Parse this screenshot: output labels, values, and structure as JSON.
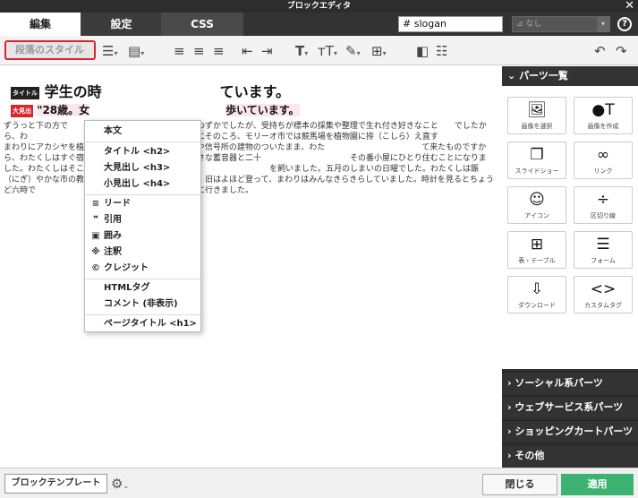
{
  "window": {
    "title": "ブロックエディタ",
    "close_glyph": "✕"
  },
  "tabs": [
    {
      "label": "編集"
    },
    {
      "label": "設定"
    },
    {
      "label": "CSS"
    }
  ],
  "header": {
    "id_field_value": "# slogan",
    "class_select_value": "なし",
    "class_select_icon": "tag-icon",
    "help_glyph": "?"
  },
  "toolbar": {
    "style_button_label": "段落のスタイル",
    "undo_icon": "undo-icon",
    "redo_icon": "redo-icon"
  },
  "content": {
    "h2_tag": "タイトル",
    "h2_text": "学生の時",
    "h2_text_tail": "ています。",
    "h3_tag": "大見出",
    "h3_text_a": "\"28歳。女",
    "h3_text_b": "歩いています。",
    "paragraph": "ずうっと下の方で　　　　　　　　　　　　　まんのわずかでしたが、受持ちが標本の採集や整理で生れ付き好きなこと　　でしたから、わ　　　　　　　　　　　　　たらきました。殊にそのころ、モリーオ市では競馬場を植物園に拵（こしら）え直す　　　　　　　　　　　　　まわりにアカシヤを植え込んだ広い地面が、切符売場や信号所の建物のついたまま、わた　　　　　　　　　　　　て来たものですから、わたくしはすぐ宿直という名前で月賦で買った小さな蓄音器と二十　　　　　　　　　　　その番小屋にひとり住むことになりました。わたくしはそこの馬を置く場所に板で小さ　　　　　　　　　　　を飼いました。五月のしまいの日曜でした。わたくしは賑（にぎ）やかな市の教会の鐘の　　　　　　　　　　　旧はよほど登って、まわりはみんなきらきらしていました。時計を見るとちょうど六時で　　　　　　　　　　　キだけ着て山羊を見に行きました。"
  },
  "style_menu": {
    "items": [
      {
        "label": "本文",
        "icon": ""
      },
      {
        "label": "タイトル <h2>",
        "icon": ""
      },
      {
        "label": "大見出し <h3>",
        "icon": ""
      },
      {
        "label": "小見出し <h4>",
        "icon": ""
      },
      {
        "label": "リード",
        "icon": "lead-icon"
      },
      {
        "label": "引用",
        "icon": "quote-icon"
      },
      {
        "label": "囲み",
        "icon": "box-icon"
      },
      {
        "label": "注釈",
        "icon": "note-icon"
      },
      {
        "label": "クレジット",
        "icon": "copyright-icon"
      },
      {
        "label": "HTMLタグ",
        "icon": ""
      },
      {
        "label": "コメント (非表示)",
        "icon": ""
      },
      {
        "label": "ページタイトル <h1>",
        "icon": ""
      }
    ]
  },
  "parts_panel": {
    "title": "パーツ一覧",
    "cards": [
      {
        "label": "画像を選択",
        "icon": "image-icon"
      },
      {
        "label": "画像を作成",
        "icon": "image-create-icon"
      },
      {
        "label": "スライドショー",
        "icon": "slideshow-icon"
      },
      {
        "label": "リンク",
        "icon": "link-icon"
      },
      {
        "label": "アイコン",
        "icon": "smiley-icon"
      },
      {
        "label": "区切り線",
        "icon": "divider-icon"
      },
      {
        "label": "表・テーブル",
        "icon": "table-icon"
      },
      {
        "label": "フォーム",
        "icon": "form-icon"
      },
      {
        "label": "ダウンロード",
        "icon": "download-icon"
      },
      {
        "label": "カスタムタグ",
        "icon": "code-icon"
      }
    ],
    "sections": [
      {
        "label": "ソーシャル系パーツ"
      },
      {
        "label": "ウェブサービス系パーツ"
      },
      {
        "label": "ショッピングカートパーツ"
      },
      {
        "label": "その他"
      }
    ]
  },
  "footer": {
    "template_button": "ブロックテンプレート",
    "close_button": "閉じる",
    "apply_button": "適用"
  },
  "colors": {
    "accent_red": "#d8262f",
    "apply_green": "#3cb371",
    "dark_chrome": "#333333"
  }
}
